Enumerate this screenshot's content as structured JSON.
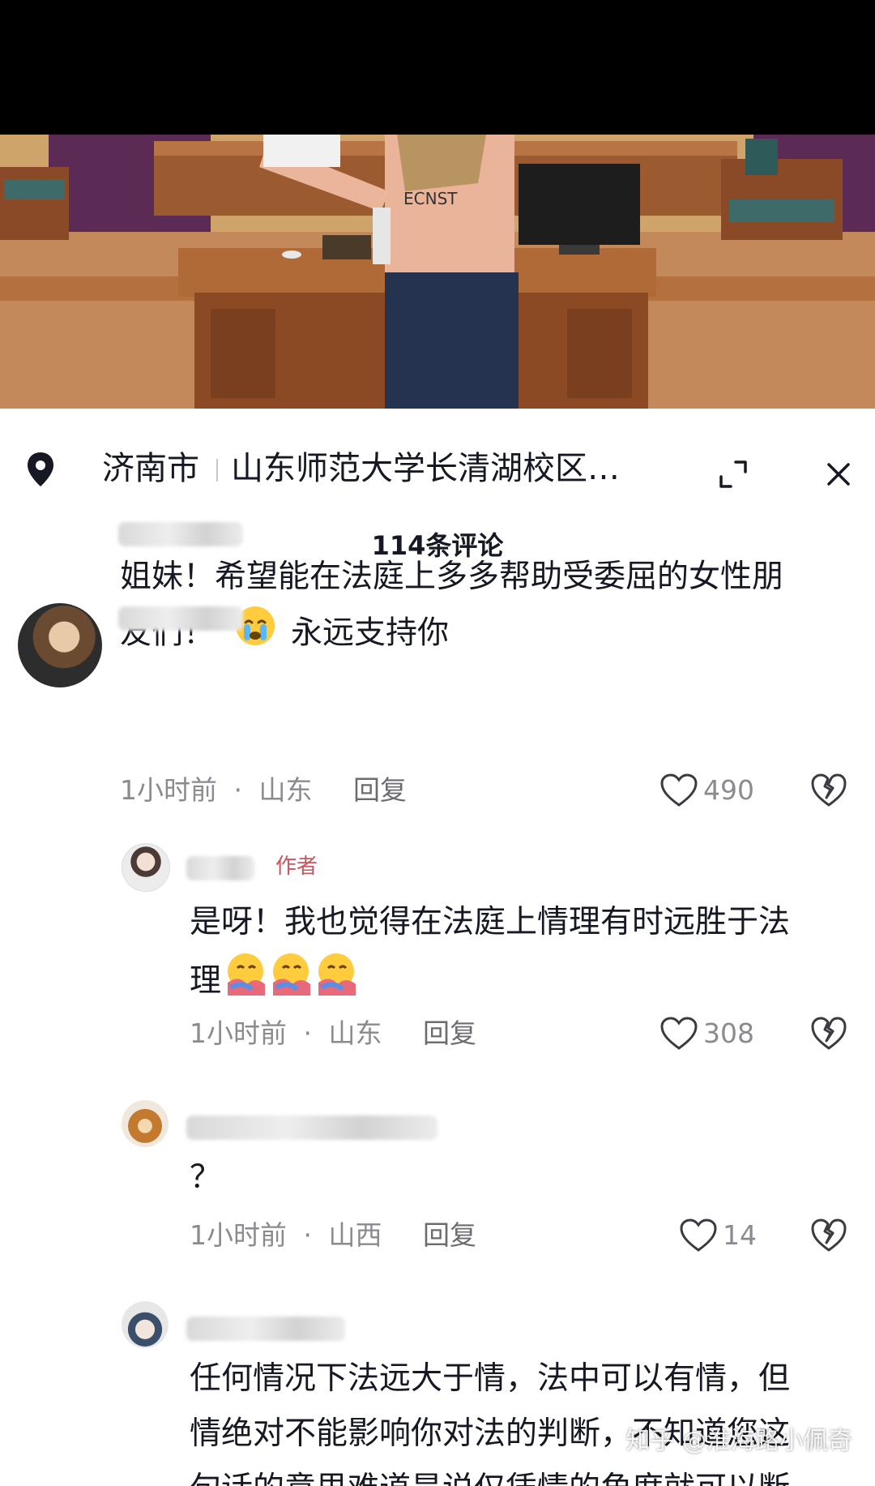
{
  "location": {
    "city": "济南市",
    "place": "山东师范大学长清湖校区…"
  },
  "comment_count_label": "114条评论",
  "comments": [
    {
      "text_line1": "姐妹！希望能在法庭上多多帮助受委屈的女性朋",
      "text_line2_a": "友们！",
      "emoji": "crying-face",
      "text_line2_b": "永远支持你",
      "time": "1小时前",
      "region": "山东",
      "reply_label": "回复",
      "likes": "490"
    },
    {
      "author_tag": "作者",
      "text_line1": "是呀！我也觉得在法庭上情理有时远胜于法",
      "text_line2": "理",
      "emoji": "hugging-face",
      "time": "1小时前",
      "region": "山东",
      "reply_label": "回复",
      "likes": "308"
    },
    {
      "text": "？",
      "time": "1小时前",
      "region": "山西",
      "reply_label": "回复",
      "likes": "14"
    },
    {
      "text_line1": "任何情况下法远大于情，法中可以有情，但",
      "text_line2": "情绝对不能影响你对法的判断，不知道您这",
      "text_line3": "句话的意思难道是说仅凭情的角度就可以断"
    }
  ],
  "meta_separator": "·",
  "watermark": "知乎 @淮海路小佩奇",
  "colors": {
    "text": "#161823",
    "meta": "#8a8b91",
    "author_tag": "#c8555f",
    "top_bar": "#000000"
  },
  "icons": [
    "location-pin-icon",
    "expand-icon",
    "close-icon",
    "heart-icon",
    "broken-heart-icon"
  ]
}
